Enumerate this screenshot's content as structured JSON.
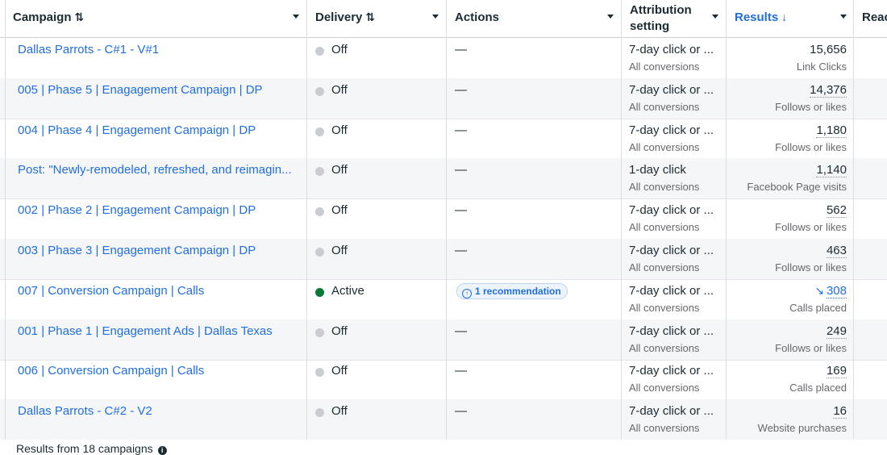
{
  "header": {
    "campaign": "Campaign",
    "delivery": "Delivery",
    "actions": "Actions",
    "attribution": "Attribution setting",
    "results": "Results",
    "reach": "Reac",
    "sort_icon": "⇅",
    "sort_down_icon": "↓"
  },
  "rows": [
    {
      "name": "Dallas Parrots - C#1 - V#1",
      "status": "Off",
      "active": false,
      "action": "—",
      "attr": "7-day click or ...",
      "attr_sub": "All conversions",
      "result": "15,656",
      "result_sub": "Link Clicks",
      "plain": true
    },
    {
      "name": "005 | Phase 5 | Enagagement Campaign | DP",
      "status": "Off",
      "active": false,
      "action": "—",
      "attr": "7-day click or ...",
      "attr_sub": "All conversions",
      "result": "14,376",
      "result_sub": "Follows or likes"
    },
    {
      "name": "004 | Phase 4 | Engagement Campaign | DP",
      "status": "Off",
      "active": false,
      "action": "—",
      "attr": "7-day click or ...",
      "attr_sub": "All conversions",
      "result": "1,180",
      "result_sub": "Follows or likes"
    },
    {
      "name": "Post: \"Newly-remodeled, refreshed, and reimagin...",
      "status": "Off",
      "active": false,
      "action": "—",
      "attr": "1-day click",
      "attr_sub": "All conversions",
      "result": "1,140",
      "result_sub": "Facebook Page visits"
    },
    {
      "name": "002 | Phase 2 | Engagement Campaign | DP",
      "status": "Off",
      "active": false,
      "action": "—",
      "attr": "7-day click or ...",
      "attr_sub": "All conversions",
      "result": "562",
      "result_sub": "Follows or likes"
    },
    {
      "name": "003 | Phase 3 | Engagement Campaign | DP",
      "status": "Off",
      "active": false,
      "action": "—",
      "attr": "7-day click or ...",
      "attr_sub": "All conversions",
      "result": "463",
      "result_sub": "Follows or likes"
    },
    {
      "name": "007 | Conversion Campaign | Calls",
      "status": "Active",
      "active": true,
      "action": "1 recommendation",
      "attr": "7-day click or ...",
      "attr_sub": "All conversions",
      "result": "308",
      "result_sub": "Calls placed",
      "trend": true
    },
    {
      "name": "001 | Phase 1 | Engagement Ads | Dallas Texas",
      "status": "Off",
      "active": false,
      "action": "—",
      "attr": "7-day click or ...",
      "attr_sub": "All conversions",
      "result": "249",
      "result_sub": "Follows or likes"
    },
    {
      "name": "006 | Conversion Campaign | Calls",
      "status": "Off",
      "active": false,
      "action": "—",
      "attr": "7-day click or ...",
      "attr_sub": "All conversions",
      "result": "169",
      "result_sub": "Calls placed"
    },
    {
      "name": "Dallas Parrots - C#2 - V2",
      "status": "Off",
      "active": false,
      "action": "—",
      "attr": "7-day click or ...",
      "attr_sub": "All conversions",
      "result": "16",
      "result_sub": "Website purchases"
    }
  ],
  "footer": {
    "text": "Results from 18 campaigns",
    "info_icon": "i"
  },
  "icons": {
    "trend": "↘",
    "recommendation": "↑"
  },
  "colors": {
    "link": "#216fdb",
    "active_dot": "#0a7a3a",
    "off_dot": "#c9ccd1"
  }
}
